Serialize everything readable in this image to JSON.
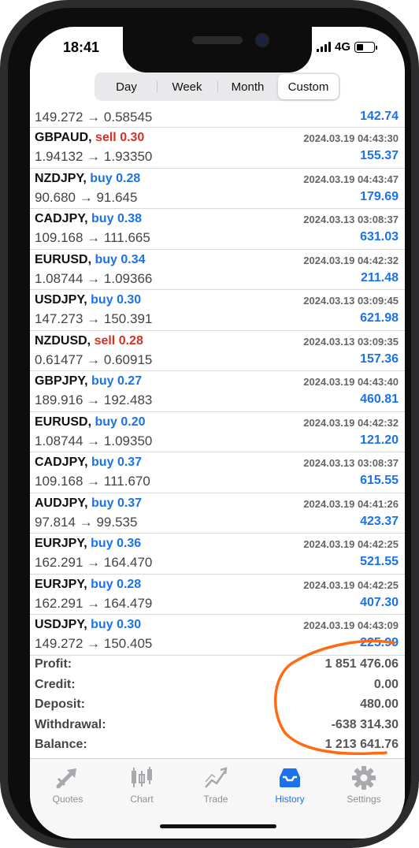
{
  "status_bar": {
    "time": "18:41",
    "network": "4G"
  },
  "period_tabs": [
    {
      "label": "Day",
      "active": false
    },
    {
      "label": "Week",
      "active": false
    },
    {
      "label": "Month",
      "active": false
    },
    {
      "label": "Custom",
      "active": true
    }
  ],
  "partial_row": {
    "prices": "149.272 → 0.58545",
    "profit": "142.74"
  },
  "trades": [
    {
      "symbol": "GBPAUD,",
      "side": "sell",
      "volume": "0.30",
      "datetime": "2024.03.19 04:43:30",
      "prices": "1.94132 → 1.93350",
      "profit": "155.37"
    },
    {
      "symbol": "NZDJPY,",
      "side": "buy",
      "volume": "0.28",
      "datetime": "2024.03.19 04:43:47",
      "prices": "90.680 → 91.645",
      "profit": "179.69"
    },
    {
      "symbol": "CADJPY,",
      "side": "buy",
      "volume": "0.38",
      "datetime": "2024.03.13 03:08:37",
      "prices": "109.168 → 111.665",
      "profit": "631.03"
    },
    {
      "symbol": "EURUSD,",
      "side": "buy",
      "volume": "0.34",
      "datetime": "2024.03.19 04:42:32",
      "prices": "1.08744 → 1.09366",
      "profit": "211.48"
    },
    {
      "symbol": "USDJPY,",
      "side": "buy",
      "volume": "0.30",
      "datetime": "2024.03.13 03:09:45",
      "prices": "147.273 → 150.391",
      "profit": "621.98"
    },
    {
      "symbol": "NZDUSD,",
      "side": "sell",
      "volume": "0.28",
      "datetime": "2024.03.13 03:09:35",
      "prices": "0.61477 → 0.60915",
      "profit": "157.36"
    },
    {
      "symbol": "GBPJPY,",
      "side": "buy",
      "volume": "0.27",
      "datetime": "2024.03.19 04:43:40",
      "prices": "189.916 → 192.483",
      "profit": "460.81"
    },
    {
      "symbol": "EURUSD,",
      "side": "buy",
      "volume": "0.20",
      "datetime": "2024.03.19 04:42:32",
      "prices": "1.08744 → 1.09350",
      "profit": "121.20"
    },
    {
      "symbol": "CADJPY,",
      "side": "buy",
      "volume": "0.37",
      "datetime": "2024.03.13 03:08:37",
      "prices": "109.168 → 111.670",
      "profit": "615.55"
    },
    {
      "symbol": "AUDJPY,",
      "side": "buy",
      "volume": "0.37",
      "datetime": "2024.03.19 04:41:26",
      "prices": "97.814 → 99.535",
      "profit": "423.37"
    },
    {
      "symbol": "EURJPY,",
      "side": "buy",
      "volume": "0.36",
      "datetime": "2024.03.19 04:42:25",
      "prices": "162.291 → 164.470",
      "profit": "521.55"
    },
    {
      "symbol": "EURJPY,",
      "side": "buy",
      "volume": "0.28",
      "datetime": "2024.03.19 04:42:25",
      "prices": "162.291 → 164.479",
      "profit": "407.30"
    },
    {
      "symbol": "USDJPY,",
      "side": "buy",
      "volume": "0.30",
      "datetime": "2024.03.19 04:43:09",
      "prices": "149.272 → 150.405",
      "profit": "225.99"
    }
  ],
  "summary": [
    {
      "label": "Profit:",
      "value": "1 851 476.06"
    },
    {
      "label": "Credit:",
      "value": "0.00"
    },
    {
      "label": "Deposit:",
      "value": "480.00"
    },
    {
      "label": "Withdrawal:",
      "value": "-638 314.30"
    },
    {
      "label": "Balance:",
      "value": "1 213 641.76"
    }
  ],
  "tab_bar": [
    {
      "label": "Quotes",
      "icon": "quotes-icon",
      "active": false
    },
    {
      "label": "Chart",
      "icon": "candlestick-chart-icon",
      "active": false
    },
    {
      "label": "Trade",
      "icon": "trade-icon",
      "active": false
    },
    {
      "label": "History",
      "icon": "history-inbox-icon",
      "active": true
    },
    {
      "label": "Settings",
      "icon": "gear-icon",
      "active": false
    }
  ],
  "colors": {
    "buy": "#1a73e8",
    "sell": "#d93025",
    "active_tab": "#1a73e8",
    "annotation": "#ff6a13"
  }
}
